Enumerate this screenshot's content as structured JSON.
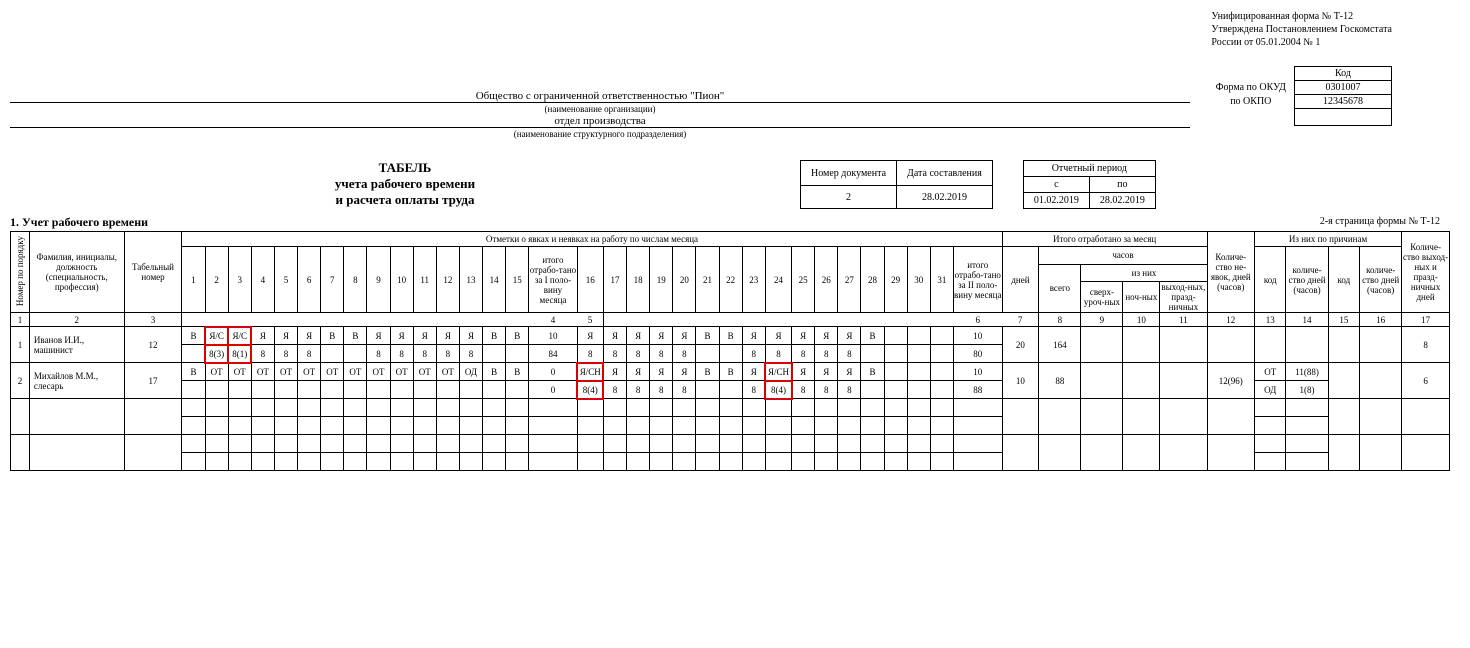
{
  "approval": {
    "l1": "Унифицированная форма № Т-12",
    "l2": "Утверждена Постановлением Госкомстата",
    "l3": "России от 05.01.2004 № 1"
  },
  "codes": {
    "header": "Код",
    "okud_label": "Форма по ОКУД",
    "okud": "0301007",
    "okpo_label": "по ОКПО",
    "okpo": "12345678"
  },
  "org": {
    "name": "Общество с ограниченной ответственностью \"Пион\"",
    "name_sub": "(наименование организации)",
    "dept": "отдел производства",
    "dept_sub": "(наименование структурного подразделения)"
  },
  "title": {
    "l1": "ТАБЕЛЬ",
    "l2": "учета рабочего времени",
    "l3": "и расчета оплаты  труда"
  },
  "doc": {
    "num_label": "Номер документа",
    "date_label": "Дата составления",
    "num": "2",
    "date": "28.02.2019"
  },
  "period": {
    "header": "Отчетный период",
    "from_label": "с",
    "to_label": "по",
    "from": "01.02.2019",
    "to": "28.02.2019"
  },
  "section": "1. Учет рабочего времени",
  "page2": "2-я страница формы № Т-12",
  "head": {
    "num": "Номер по порядку",
    "fio": "Фамилия, инициалы, должность (специальность, профессия)",
    "tab": "Табельный номер",
    "marks": "Отметки о явках и неявках на работу по числам месяца",
    "half1": "итого отрабо-тано за I поло-вину месяца",
    "half2": "итого отрабо-тано за II поло-вину месяца",
    "total": "Итого отработано за месяц",
    "days": "дней",
    "hours": "часов",
    "vsego": "всего",
    "iznih": "из них",
    "over": "сверх-уроч-ных",
    "night": "ноч-ных",
    "weekend": "выход-ных, празд-ничных",
    "absent": "Количе-ство не-явок, дней (часов)",
    "reasons": "Из них по причинам",
    "code": "код",
    "cnt": "количе-ство дней (часов)",
    "holi": "Количе-ство выход-ных и празд-ничных дней",
    "d1": "1",
    "d2": "2",
    "d3": "3",
    "d4": "4",
    "d5": "5",
    "d6": "6",
    "d7": "7",
    "d8": "8",
    "d9": "9",
    "d10": "10",
    "d11": "11",
    "d12": "12",
    "d13": "13",
    "d14": "14",
    "d15": "15",
    "d16": "16",
    "d17": "17",
    "d18": "18",
    "d19": "19",
    "d20": "20",
    "d21": "21",
    "d22": "22",
    "d23": "23",
    "d24": "24",
    "d25": "25",
    "d26": "26",
    "d27": "27",
    "d28": "28",
    "d29": "29",
    "d30": "30",
    "d31": "31"
  },
  "colnums": {
    "c1": "1",
    "c2": "2",
    "c3": "3",
    "c4": "4",
    "c5": "5",
    "c6": "6",
    "c7": "7",
    "c8": "8",
    "c9": "9",
    "c10": "10",
    "c11": "11",
    "c12": "12",
    "c13": "13",
    "c14": "14",
    "c15": "15",
    "c16": "16",
    "c17": "17"
  },
  "r1": {
    "num": "1",
    "fio": "Иванов И.И., машинист",
    "tab": "12",
    "c": {
      "1": "В",
      "2": "Я/С",
      "3": "Я/С",
      "4": "Я",
      "5": "Я",
      "6": "Я",
      "7": "В",
      "8": "В",
      "9": "Я",
      "10": "Я",
      "11": "Я",
      "12": "Я",
      "13": "Я",
      "14": "В",
      "15": "В"
    },
    "h1": "10",
    "c2": {
      "16": "Я",
      "17": "Я",
      "18": "Я",
      "19": "Я",
      "20": "Я",
      "21": "В",
      "22": "В",
      "23": "Я",
      "24": "Я",
      "25": "Я",
      "26": "Я",
      "27": "Я",
      "28": "В",
      "29": "",
      "30": "",
      "31": ""
    },
    "h2": "10",
    "days": "20",
    "hours": "164",
    "holi": "8",
    "b": {
      "1": "",
      "2": "8(3)",
      "3": "8(1)",
      "4": "8",
      "5": "8",
      "6": "8",
      "7": "",
      "8": "",
      "9": "8",
      "10": "8",
      "11": "8",
      "12": "8",
      "13": "8",
      "14": "",
      "15": ""
    },
    "bh1": "84",
    "b2": {
      "16": "8",
      "17": "8",
      "18": "8",
      "19": "8",
      "20": "8",
      "21": "",
      "22": "",
      "23": "8",
      "24": "8",
      "25": "8",
      "26": "8",
      "27": "8",
      "28": "",
      "29": "",
      "30": "",
      "31": ""
    },
    "bh2": "80"
  },
  "r2": {
    "num": "2",
    "fio": "Михайлов М.М., слесарь",
    "tab": "17",
    "c": {
      "1": "В",
      "2": "ОТ",
      "3": "ОТ",
      "4": "ОТ",
      "5": "ОТ",
      "6": "ОТ",
      "7": "ОТ",
      "8": "ОТ",
      "9": "ОТ",
      "10": "ОТ",
      "11": "ОТ",
      "12": "ОТ",
      "13": "ОД",
      "14": "В",
      "15": "В"
    },
    "h1": "0",
    "c2": {
      "16": "Я/СН",
      "17": "Я",
      "18": "Я",
      "19": "Я",
      "20": "Я",
      "21": "В",
      "22": "В",
      "23": "Я",
      "24": "Я/СН",
      "25": "Я",
      "26": "Я",
      "27": "Я",
      "28": "В",
      "29": "",
      "30": "",
      "31": ""
    },
    "h2": "10",
    "days": "10",
    "hours": "88",
    "absent": "12(96)",
    "reason_code": "ОТ",
    "reason_cnt": "11(88)",
    "reason_code2": "ОД",
    "reason_cnt2": "1(8)",
    "holi": "6",
    "b": {
      "1": "",
      "2": "",
      "3": "",
      "4": "",
      "5": "",
      "6": "",
      "7": "",
      "8": "",
      "9": "",
      "10": "",
      "11": "",
      "12": "",
      "13": "",
      "14": "",
      "15": ""
    },
    "bh1": "0",
    "b2": {
      "16": "8(4)",
      "17": "8",
      "18": "8",
      "19": "8",
      "20": "8",
      "21": "",
      "22": "",
      "23": "8",
      "24": "8(4)",
      "25": "8",
      "26": "8",
      "27": "8",
      "28": "",
      "29": "",
      "30": "",
      "31": ""
    },
    "bh2": "88"
  }
}
